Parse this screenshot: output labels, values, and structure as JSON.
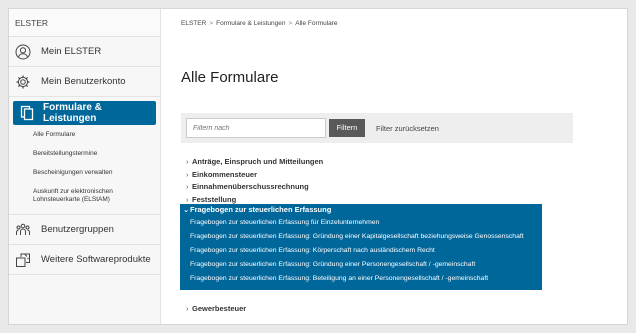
{
  "sidebar": {
    "brand": "ELSTER",
    "items": [
      {
        "label": "Mein ELSTER",
        "icon": "user-circle-icon"
      },
      {
        "label": "Mein Benutzerkonto",
        "icon": "gear-icon"
      }
    ],
    "active": {
      "label": "Formulare & Leistungen",
      "icon": "documents-icon"
    },
    "subitems": [
      "Alle Formulare",
      "Bereitstellungstermine",
      "Bescheinigungen verwalten",
      "Auskunft zur elektronischen Lohnsteuerkarte (ELStAM)"
    ],
    "bottom_items": [
      {
        "label": "Benutzergruppen",
        "icon": "user-group-icon"
      },
      {
        "label": "Weitere Softwareprodukte",
        "icon": "software-icon"
      }
    ]
  },
  "breadcrumb": [
    "ELSTER",
    "Formulare & Leistungen",
    "Alle Formulare"
  ],
  "page_title": "Alle Formulare",
  "filter": {
    "placeholder": "Filtern nach",
    "button": "Filtern",
    "reset": "Filter zurücksetzen"
  },
  "categories": [
    "Anträge, Einspruch und Mitteilungen",
    "Einkommensteuer",
    "Einnahmenüberschussrechnung",
    "Feststellung"
  ],
  "open_category": {
    "label": "Fragebogen zur steuerlichen Erfassung",
    "forms": [
      "Fragebogen zur steuerlichen Erfassung für Einzelunternehmen",
      "Fragebogen zur steuerlichen Erfassung: Gründung einer Kapitalgesellschaft beziehungsweise Genossenschaft",
      "Fragebogen zur steuerlichen Erfassung: Körperschaft nach ausländischem Recht",
      "Fragebogen zur steuerlichen Erfassung: Gründung einer Personengesellschaft / -gemeinschaft",
      "Fragebogen zur steuerlichen Erfassung: Beteiligung an einer Personengesellschaft / -gemeinschaft"
    ]
  },
  "next_category": "Gewerbesteuer",
  "colors": {
    "accent": "#00679b",
    "button": "#595959"
  }
}
